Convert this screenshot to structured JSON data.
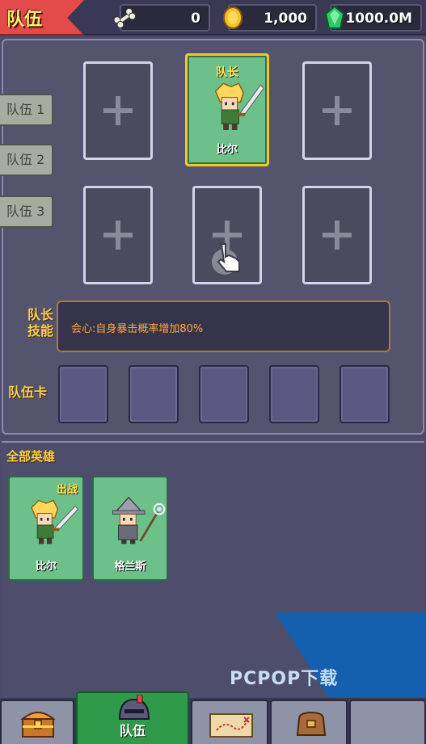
{
  "header": {
    "title": "队伍",
    "resources": [
      {
        "icon": "bone-icon",
        "value": "0"
      },
      {
        "icon": "gold-coin-icon",
        "value": "1,000"
      },
      {
        "icon": "green-gem-icon",
        "value": "1000.0M"
      }
    ]
  },
  "team": {
    "tabs": [
      "队伍 1",
      "队伍 2",
      "队伍 3"
    ],
    "leader_label": "队长",
    "leader_name": "比尔",
    "leader_skill_label": "队长\n技能",
    "leader_skill_text": "会心:自身暴击概率增加80%",
    "team_card_label": "队伍卡"
  },
  "heroes": {
    "header": "全部英雄",
    "list": [
      {
        "name": "比尔",
        "badge": "出战"
      },
      {
        "name": "格兰斯",
        "badge": ""
      }
    ]
  },
  "nav": {
    "team_label": "队伍"
  },
  "watermark": "PCPOP下载",
  "colors": {
    "accent_red": "#e44a4a",
    "gold_text": "#ffcf4a",
    "hero_card_green": "#6ec08a",
    "active_nav_green": "#2e9a4a",
    "watermark_blue": "#145fae"
  }
}
